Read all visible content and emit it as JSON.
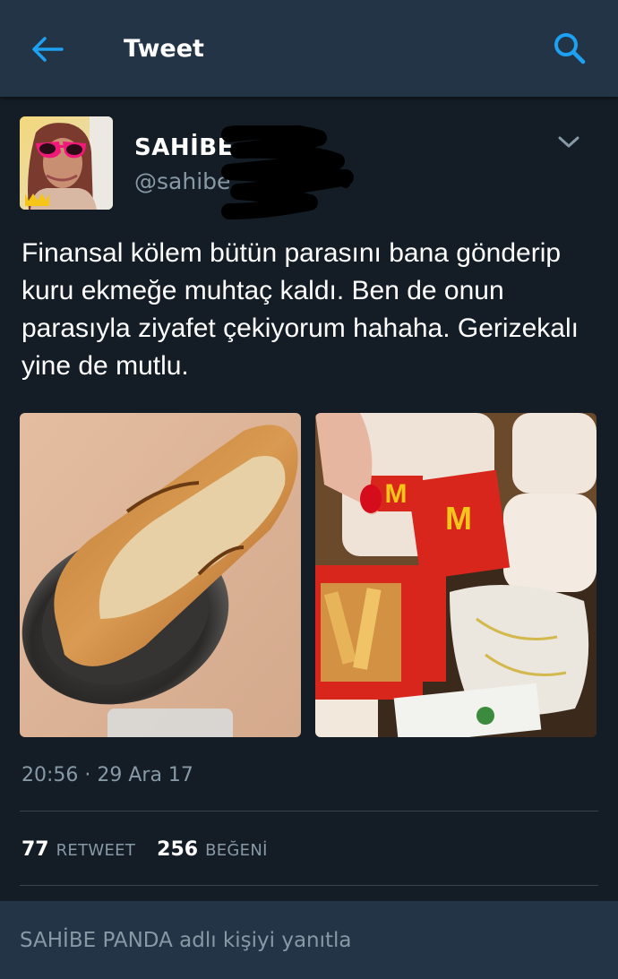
{
  "header": {
    "title": "Tweet",
    "back_icon": "arrow-left-icon",
    "search_icon": "search-icon"
  },
  "tweet": {
    "display_name": "SAHİBE",
    "handle": "@sahibe",
    "text": "Finansal kölem bütün parasını bana gönderip kuru ekmeğe muhtaç kaldı. Ben de onun parasıyla ziyafet çekiyorum hahaha. Gerizekalı yine de mutlu.",
    "timestamp": "20:56 · 29 Ara 17",
    "retweet_count": "77",
    "retweet_label": "RETWEET",
    "like_count": "256",
    "like_label": "BEĞENİ"
  },
  "reply": {
    "placeholder": "SAHİBE PANDA adlı kişiyi yanıtla"
  },
  "colors": {
    "background": "#141d26",
    "header": "#243447",
    "accent": "#1da1f2",
    "muted": "#8899a6",
    "divider": "#38444d"
  }
}
